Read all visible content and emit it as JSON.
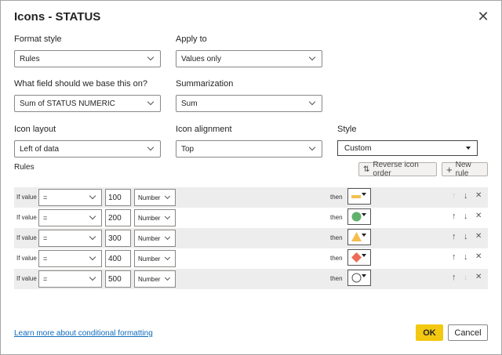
{
  "dialog": {
    "title": "Icons - STATUS",
    "close_icon": "close-icon"
  },
  "fields": {
    "format_style": {
      "label": "Format style",
      "value": "Rules"
    },
    "apply_to": {
      "label": "Apply to",
      "value": "Values only"
    },
    "base_field": {
      "label": "What field should we base this on?",
      "value": "Sum of STATUS NUMERIC"
    },
    "summarization": {
      "label": "Summarization",
      "value": "Sum"
    },
    "icon_layout": {
      "label": "Icon layout",
      "value": "Left of data"
    },
    "icon_alignment": {
      "label": "Icon alignment",
      "value": "Top"
    },
    "style": {
      "label": "Style",
      "value": "Custom"
    }
  },
  "rules": {
    "label": "Rules",
    "reverse_label": "Reverse icon order",
    "new_rule_label": "New rule",
    "items": [
      {
        "prefix": "If value",
        "operator": "=",
        "value": "100",
        "type": "Number",
        "then": "then",
        "icon": "yellow-bar",
        "color": "#F2C14E"
      },
      {
        "prefix": "If value",
        "operator": "=",
        "value": "200",
        "type": "Number",
        "then": "then",
        "icon": "green-circle",
        "color": "#5FB16B"
      },
      {
        "prefix": "If value",
        "operator": "=",
        "value": "300",
        "type": "Number",
        "then": "then",
        "icon": "yellow-triangle",
        "color": "#F5BE4F"
      },
      {
        "prefix": "If value",
        "operator": "=",
        "value": "400",
        "type": "Number",
        "then": "then",
        "icon": "red-diamond",
        "color": "#EE6B57"
      },
      {
        "prefix": "If value",
        "operator": "=",
        "value": "500",
        "type": "Number",
        "then": "then",
        "icon": "empty-circle",
        "color": "#555555"
      }
    ]
  },
  "footer": {
    "learn_more": "Learn more about conditional formatting",
    "ok": "OK",
    "cancel": "Cancel"
  },
  "colors": {
    "accent": "#F2C811",
    "link": "#0F6CBD"
  }
}
